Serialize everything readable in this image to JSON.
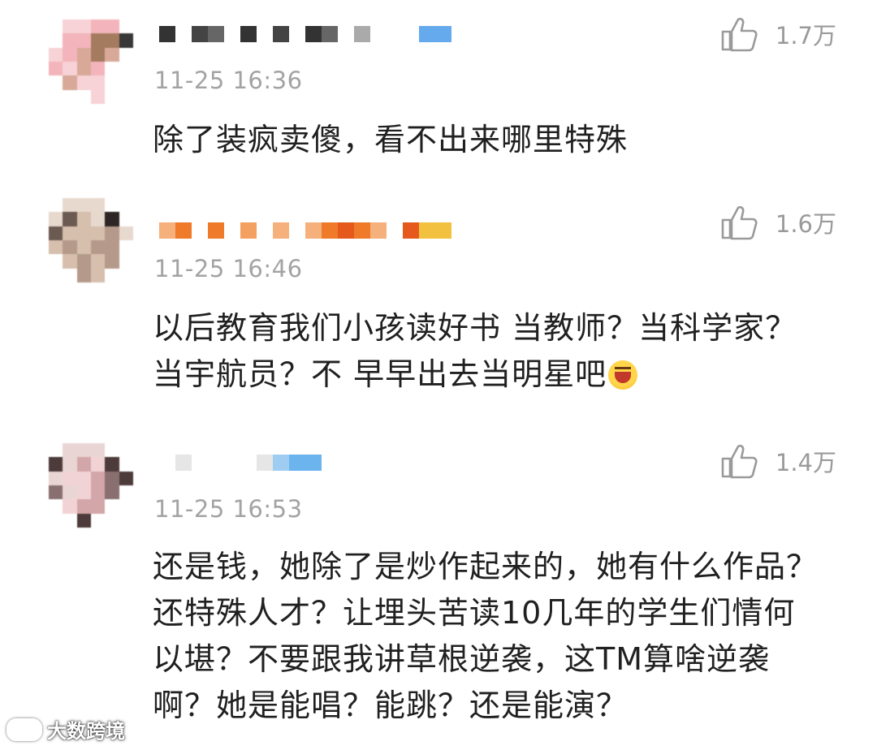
{
  "comments": [
    {
      "time": "11-25 16:36",
      "likes": "1.7万",
      "text": "除了装疯卖傻，看不出来哪里特殊",
      "avatar_colors": [
        "#f7d2d6",
        "#f3b5bb",
        "#a57b60",
        "#d8a998",
        "#383838",
        "#ffffff"
      ],
      "name_colors": [
        "#333333",
        "#444444",
        "#666666",
        "#aaaaaa",
        "#66aaee"
      ]
    },
    {
      "time": "11-25 16:46",
      "likes": "1.6万",
      "text": "以后教育我们小孩读好书 当教师？当科学家？当宇航员？不 早早出去当明星吧",
      "avatar_colors": [
        "#e8d9cf",
        "#6b5a52",
        "#2e2624",
        "#d7bfae",
        "#b59a8b",
        "#ffffff"
      ],
      "name_colors": [
        "#f6b07c",
        "#ee7a2a",
        "#f4a060",
        "#e55a1c",
        "#f3c140"
      ]
    },
    {
      "time": "11-25 16:53",
      "likes": "1.4万",
      "text": "还是钱，她除了是炒作起来的，她有什么作品？还特殊人才？让埋头苦读10几年的学生们情何以堪？不要跟我讲草根逆袭，这TM算啥逆袭啊？她是能唱？能跳？还是能演？",
      "avatar_colors": [
        "#e9d6d4",
        "#4d3b3b",
        "#d3a6a9",
        "#f2d3d5",
        "#8a6f70",
        "#ffffff"
      ],
      "name_colors": [
        "#e6e6e6",
        "#cfe3f7",
        "#6cb4ee",
        "#9fcdf2",
        "#ffffff"
      ]
    }
  ],
  "watermark": "大数跨境"
}
